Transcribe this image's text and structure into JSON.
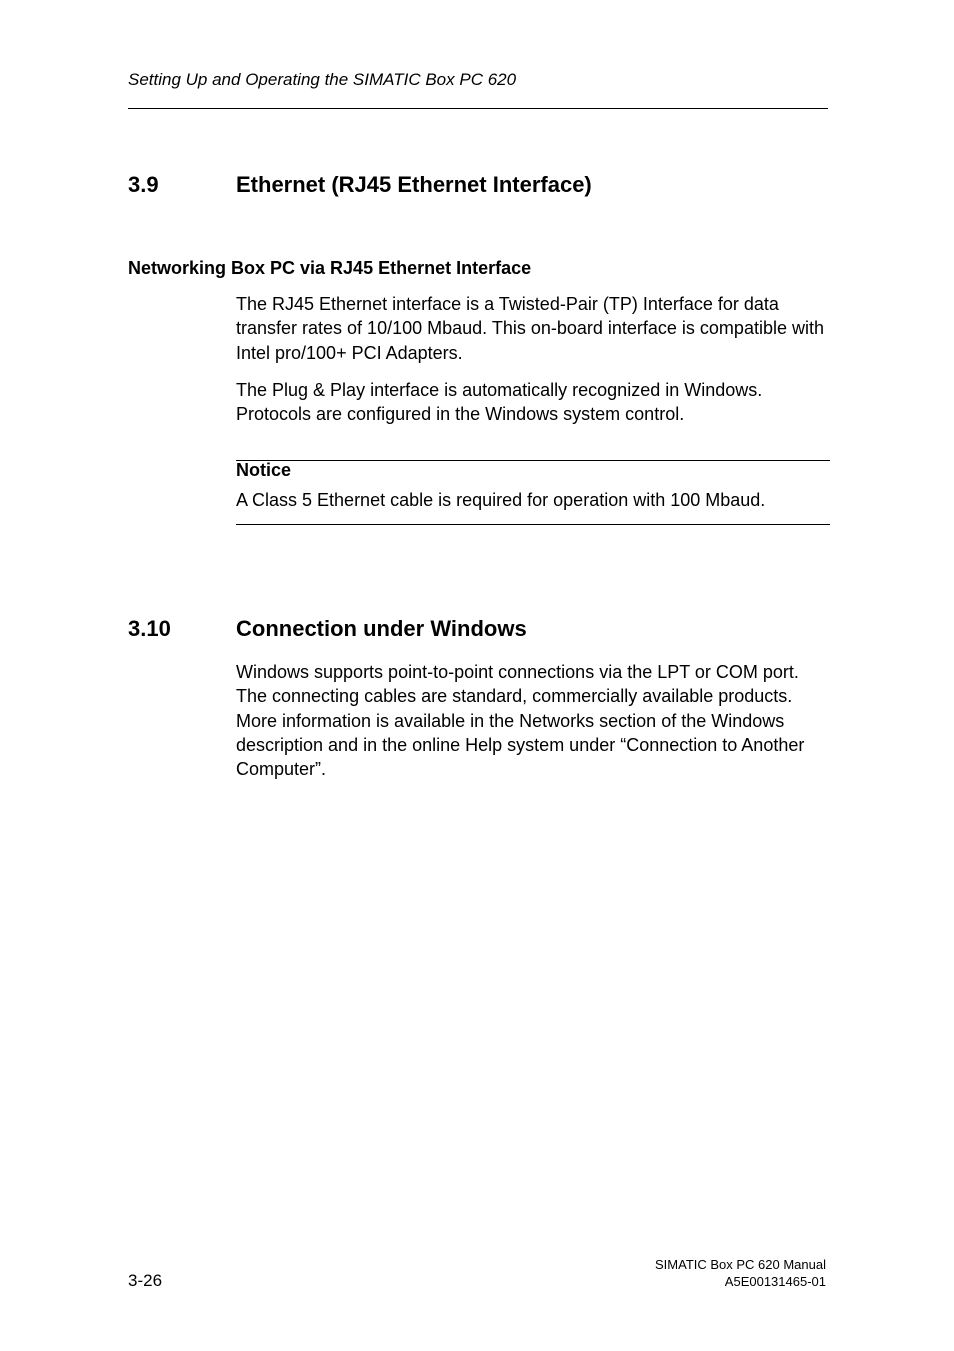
{
  "header": {
    "running_title": "Setting Up and Operating the SIMATIC Box PC 620"
  },
  "section39": {
    "number": "3.9",
    "title": "Ethernet (RJ45 Ethernet Interface)",
    "subhead": "Networking Box PC via RJ45 Ethernet Interface",
    "para1": "The RJ45 Ethernet interface is a Twisted-Pair (TP) Interface for data transfer rates of 10/100 Mbaud. This on-board interface is compatible with Intel pro/100+ PCI Adapters.",
    "para2": "The Plug & Play interface is automatically recognized in Windows. Protocols are configured in the Windows system control.",
    "notice_label": "Notice",
    "notice_text": "A Class 5 Ethernet cable is required for operation with 100 Mbaud."
  },
  "section310": {
    "number": "3.10",
    "title": "Connection under Windows",
    "para1": "Windows supports point-to-point connections via the LPT or COM port. The connecting cables are standard, commercially available products. More information is available in the Networks section of the Windows description and in the online Help system under “Connection to Another Computer”."
  },
  "footer": {
    "page_num": "3-26",
    "doc_title": "SIMATIC Box PC 620  Manual",
    "doc_id": "A5E00131465-01"
  }
}
